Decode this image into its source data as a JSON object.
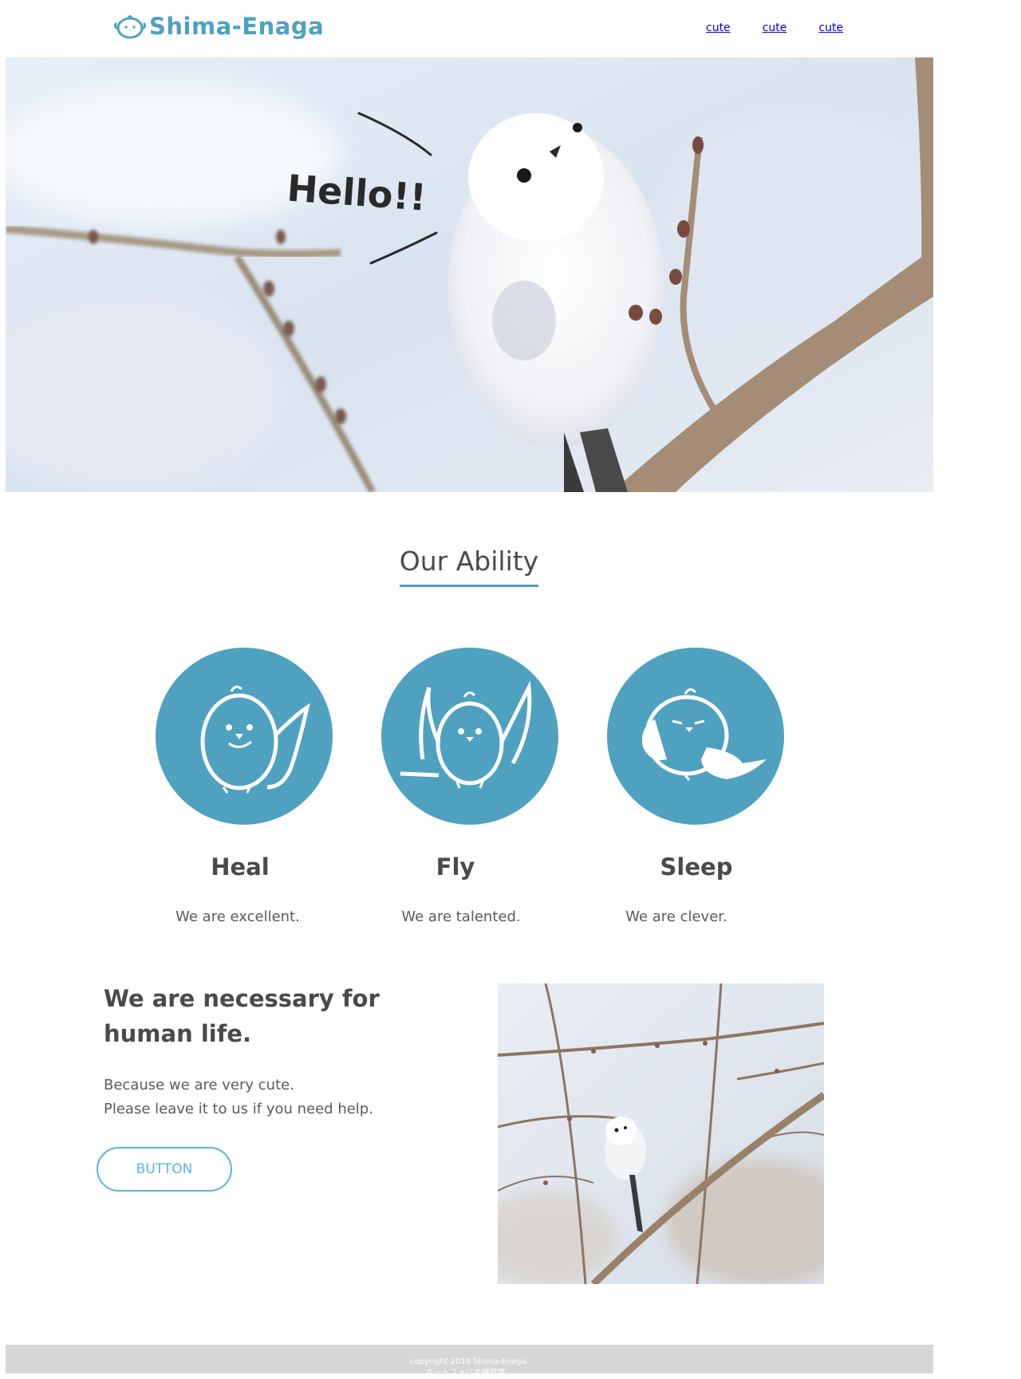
{
  "header": {
    "logo_text": "Shima-Enaga",
    "nav": [
      "cute",
      "cute",
      "cute"
    ]
  },
  "hero": {
    "greeting": "Hello!!",
    "image": "long-tailed-tit-on-branch-photo"
  },
  "abilities": {
    "title": "Our Ability",
    "items": [
      {
        "title": "Heal",
        "text": "We are excellent.",
        "icon": "smiling-bird-icon"
      },
      {
        "title": "Fly",
        "text": "We are talented.",
        "icon": "flying-bird-icon"
      },
      {
        "title": "Sleep",
        "text": "We are clever.",
        "icon": "sleeping-bird-icon"
      }
    ]
  },
  "about": {
    "heading_line1": "We are necessary for",
    "heading_line2": "human life.",
    "text_line1": "Because we are very cute.",
    "text_line2": "Please leave it to us if you need help.",
    "button_label": "BUTTON",
    "image": "bird-among-branches-photo"
  },
  "footer": {
    "copyright": "copyright 2019 Shima-Enaga.",
    "note": "ポートフォリオ練習用。"
  },
  "colors": {
    "accent": "#4ea1bf",
    "button": "#5ab4e0",
    "text": "#4a4a4a",
    "footer_bg": "#d6d6d6"
  }
}
